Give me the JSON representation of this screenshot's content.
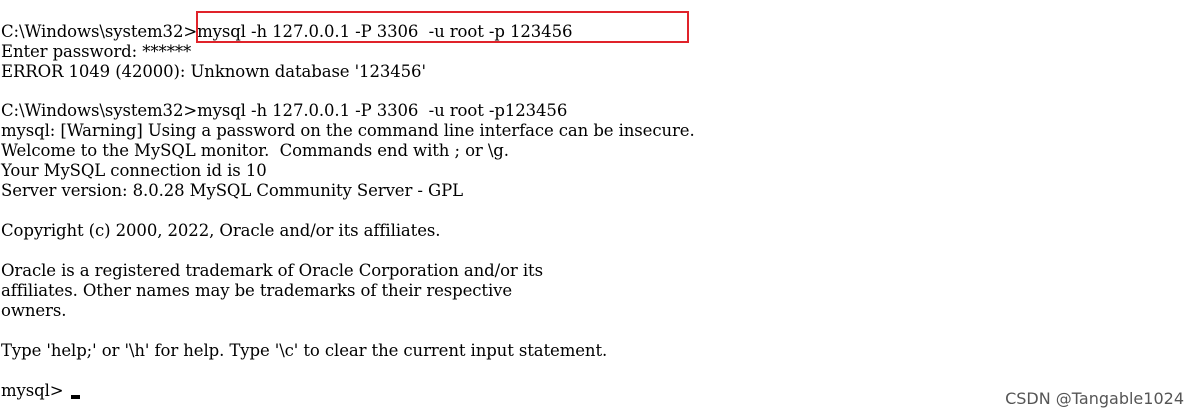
{
  "terminal": {
    "lines": [
      "C:\\Windows\\system32>mysql -h 127.0.0.1 -P 3306  -u root -p 123456",
      "Enter password: ******",
      "ERROR 1049 (42000): Unknown database '123456'",
      "",
      "C:\\Windows\\system32>mysql -h 127.0.0.1 -P 3306  -u root -p123456",
      "mysql: [Warning] Using a password on the command line interface can be insecure.",
      "Welcome to the MySQL monitor.  Commands end with ; or \\g.",
      "Your MySQL connection id is 10",
      "Server version: 8.0.28 MySQL Community Server - GPL",
      "",
      "Copyright (c) 2000, 2022, Oracle and/or its affiliates.",
      "",
      "Oracle is a registered trademark of Oracle Corporation and/or its",
      "affiliates. Other names may be trademarks of their respective",
      "owners.",
      "",
      "Type 'help;' or '\\h' for help. Type '\\c' to clear the current input statement.",
      "",
      "mysql> "
    ],
    "highlight_color": "#e0232a"
  },
  "watermark": {
    "text": "CSDN @Tangable1024"
  }
}
